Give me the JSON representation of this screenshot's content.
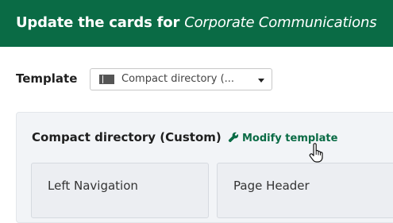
{
  "header": {
    "title_prefix": "Update the cards for",
    "title_group": "Corporate Communications",
    "background_color": "#0a6b45"
  },
  "template": {
    "label": "Template",
    "select_value": "Compact directory (...",
    "select_icon": "layout-icon"
  },
  "panel": {
    "title": "Compact directory (Custom)",
    "modify_link": "Modify template",
    "modify_icon": "wrench-icon",
    "cards": [
      {
        "label": "Left Navigation"
      },
      {
        "label": "Page Header"
      }
    ]
  },
  "cursor": {
    "type": "hand-pointer"
  }
}
